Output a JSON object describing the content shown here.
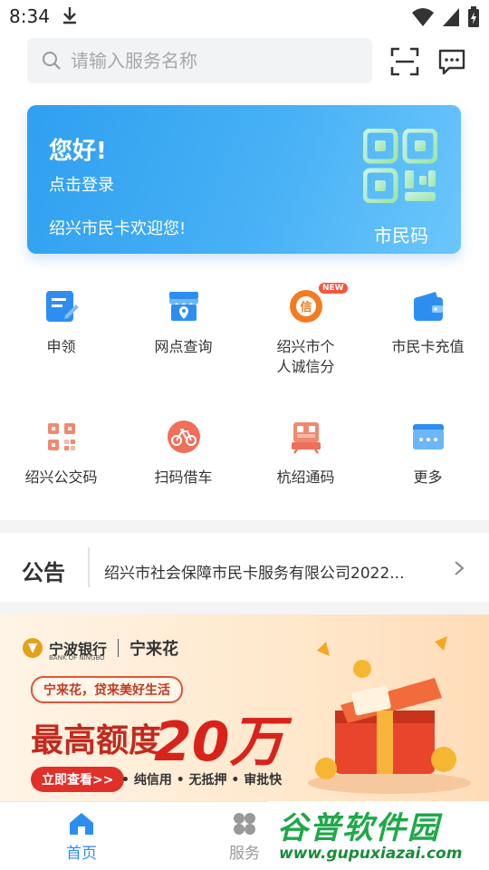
{
  "status_bar": {
    "time": "8:34"
  },
  "search": {
    "placeholder": "请输入服务名称"
  },
  "card": {
    "greeting": "您好!",
    "login": "点击登录",
    "welcome": "绍兴市民卡欢迎您!",
    "qr_label": "市民码"
  },
  "grid": [
    {
      "label": "申领",
      "icon": "form-edit-icon"
    },
    {
      "label": "网点查询",
      "icon": "store-location-icon"
    },
    {
      "label": "绍兴市个人诚信分",
      "icon": "credit-score-icon",
      "badge": "NEW"
    },
    {
      "label": "市民卡充值",
      "icon": "wallet-icon"
    },
    {
      "label": "绍兴公交码",
      "icon": "bus-qr-icon"
    },
    {
      "label": "扫码借车",
      "icon": "bicycle-icon"
    },
    {
      "label": "杭绍通码",
      "icon": "transit-qr-icon"
    },
    {
      "label": "更多",
      "icon": "more-icon"
    }
  ],
  "notice": {
    "title": "公告",
    "text": "绍兴市社会保障市民卡服务有限公司2022..."
  },
  "ad": {
    "bank": "宁波银行",
    "bank_en": "BANK OF NINGBO",
    "brand": "宁来花",
    "slogan": "宁来花，贷来美好生活",
    "headline": "最高额度",
    "amount": "20万",
    "cta": "立即查看>>",
    "features": "• 纯信用 • 无抵押 • 审批快"
  },
  "nav": {
    "home": "首页",
    "service": "服务"
  },
  "watermark": {
    "title": "谷普软件园",
    "url": "www.gupuxiazai.com"
  },
  "colors": {
    "accent": "#2e8ef0",
    "card_start": "#2f9ff0",
    "card_end": "#6cc6fb",
    "ad_red": "#d8231b"
  }
}
